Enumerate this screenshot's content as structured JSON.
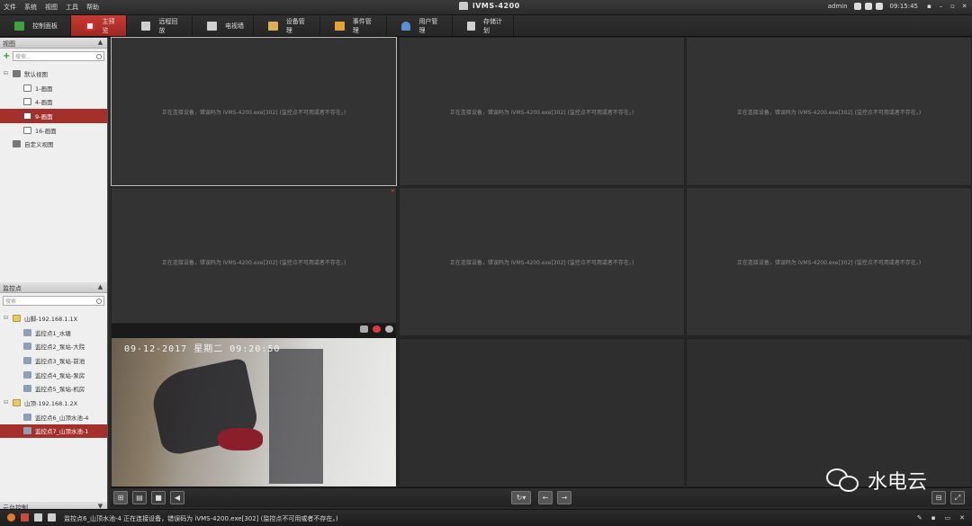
{
  "menu": [
    "文件",
    "系统",
    "视图",
    "工具",
    "帮助"
  ],
  "app_title": "iVMS-4200",
  "user": "admin",
  "clock": "09:15:45",
  "window_controls": [
    "▪",
    "–",
    "▫",
    "✕"
  ],
  "tabs": [
    {
      "label": "控制面板",
      "icon": "control-panel-icon",
      "color": "#3fa23f"
    },
    {
      "label": "主预览",
      "icon": "preview-icon",
      "color": "#e7e7e7",
      "active": true
    },
    {
      "label": "远程回放",
      "icon": "playback-icon",
      "color": "#d8d8d8"
    },
    {
      "label": "电视墙",
      "icon": "tv-wall-icon",
      "color": "#d8d8d8"
    },
    {
      "label": "设备管理",
      "icon": "device-icon",
      "color": "#d8b15a"
    },
    {
      "label": "事件管理",
      "icon": "event-icon",
      "color": "#e3a236"
    },
    {
      "label": "用户管理",
      "icon": "user-icon",
      "color": "#5b8fd3"
    },
    {
      "label": "存储计划",
      "icon": "storage-icon",
      "color": "#d8d8d8"
    }
  ],
  "views_panel": {
    "title": "视图",
    "search_placeholder": "搜索...",
    "items": [
      {
        "label": "默认视图",
        "level": 0,
        "expander": "⊟"
      },
      {
        "label": "1-画面",
        "level": 1
      },
      {
        "label": "4-画面",
        "level": 1
      },
      {
        "label": "9-画面",
        "level": 1,
        "selected": true
      },
      {
        "label": "16-画面",
        "level": 1
      },
      {
        "label": "自定义视图",
        "level": 0,
        "expander": ""
      }
    ]
  },
  "camera_panel": {
    "title": "监控点",
    "search_placeholder": "搜索",
    "items": [
      {
        "label": "山脚-192.168.1.1X",
        "level": 0,
        "folder": true
      },
      {
        "label": "监控点1_水塘",
        "level": 1
      },
      {
        "label": "监控点2_泵站-大院",
        "level": 1
      },
      {
        "label": "监控点3_泵站-前池",
        "level": 1
      },
      {
        "label": "监控点4_泵站-泵房",
        "level": 1
      },
      {
        "label": "监控点5_泵站-机房",
        "level": 1
      },
      {
        "label": "山顶-192.168.1.2X",
        "level": 0,
        "folder": true
      },
      {
        "label": "监控点6_山顶水池-4",
        "level": 1
      },
      {
        "label": "监控点7_山顶水池-1",
        "level": 1,
        "selected": true
      }
    ]
  },
  "ptz_panel": {
    "title": "云台控制"
  },
  "cell_message": "正在连接设备，错误码为 iVMS-4200.exe[302] (监控点不可用或者不存在。)",
  "video_timestamp": "09-12-2017 星期二 09:20:50",
  "status_text": "监控点6_山顶水池-4 正在连接设备，错误码为 iVMS-4200.exe[302] (监控点不可用或者不存在。)",
  "status_right": [
    "✎",
    "▪",
    "▭",
    "✕"
  ],
  "watermark": "水电云"
}
